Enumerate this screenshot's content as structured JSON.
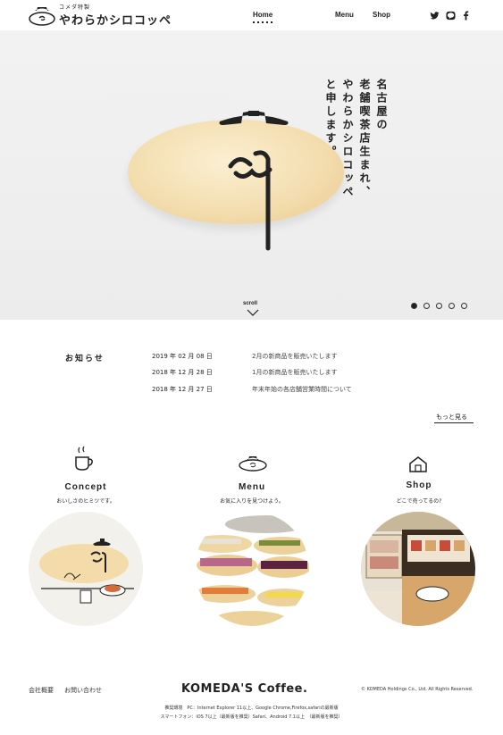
{
  "header": {
    "logo_sub": "コメダ特製",
    "logo_main": "やわらかシロコッペ",
    "nav": [
      {
        "label": "Home"
      },
      {
        "label": "Menu"
      },
      {
        "label": "Shop"
      }
    ],
    "social_icons": [
      "twitter-icon",
      "line-icon",
      "facebook-icon"
    ]
  },
  "hero": {
    "lines": [
      "名古屋の",
      "老舗喫茶店生まれ、",
      "やわらかシロコッペ",
      "と申します。"
    ],
    "scroll_label": "scroll",
    "slides": 5,
    "active_slide": 1
  },
  "news": {
    "title": "お知らせ",
    "items": [
      {
        "date": "2019 年 02 月 08 日",
        "text": "2月の新商品を販売いたします"
      },
      {
        "date": "2018 年 12 月 28 日",
        "text": "1月の新商品を販売いたします"
      },
      {
        "date": "2018 年 12 月 27 日",
        "text": "年末年始の各店舗営業時間について"
      }
    ],
    "more": "もっと見る"
  },
  "sections": [
    {
      "title": "Concept",
      "subtitle": "おいしさのヒミツです。",
      "icon": "coffee-cup-icon"
    },
    {
      "title": "Menu",
      "subtitle": "お気に入りを見つけよう。",
      "icon": "bread-icon"
    },
    {
      "title": "Shop",
      "subtitle": "どこで売ってるの?",
      "icon": "house-icon"
    }
  ],
  "footer": {
    "links": [
      "会社概要",
      "お問い合わせ"
    ],
    "brand": "KOMEDA'S Coffee.",
    "copyright": "© KOMEDA Holdings Co., Ltd. All Rights Reserved.",
    "env_line1": "推奨環境　PC：Internet Explorer 11以上、Google Chrome,Firefox,safariの最新版",
    "env_line2": "スマートフォン：iOS 7以上（最新版を推奨）Safari、Android 7.1以上　（最新版を推奨）"
  }
}
